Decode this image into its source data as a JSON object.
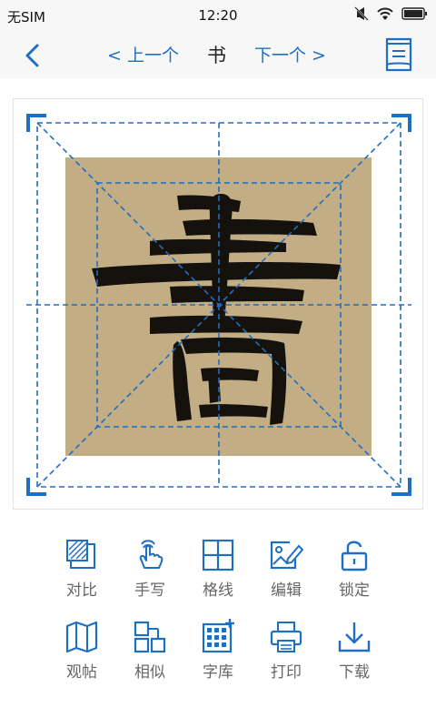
{
  "status": {
    "carrier": "无SIM",
    "time": "12:20"
  },
  "nav": {
    "prev_label": "< 上一个",
    "title": "书",
    "next_label": "下一个 >"
  },
  "colors": {
    "accent": "#1e6fc1",
    "paper": "#c3ad84",
    "ink": "#15120e"
  },
  "tools": [
    {
      "label": "对比",
      "icon": "compare-icon"
    },
    {
      "label": "手写",
      "icon": "handwrite-icon"
    },
    {
      "label": "格线",
      "icon": "grid-icon"
    },
    {
      "label": "编辑",
      "icon": "edit-image-icon"
    },
    {
      "label": "锁定",
      "icon": "lock-icon"
    },
    {
      "label": "观帖",
      "icon": "map-icon"
    },
    {
      "label": "相似",
      "icon": "similar-icon"
    },
    {
      "label": "字库",
      "icon": "char-library-icon"
    },
    {
      "label": "打印",
      "icon": "printer-icon"
    },
    {
      "label": "下载",
      "icon": "download-icon"
    }
  ]
}
